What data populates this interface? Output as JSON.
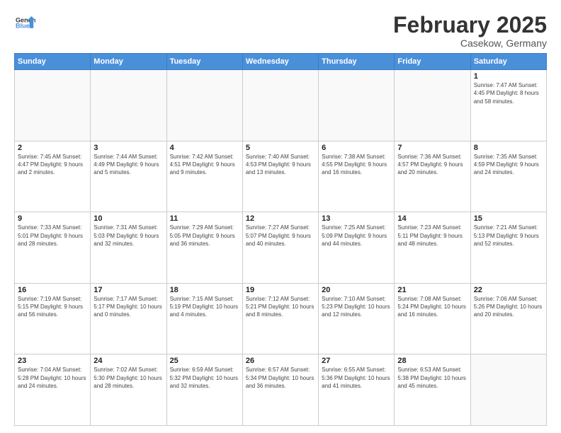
{
  "header": {
    "logo_line1": "General",
    "logo_line2": "Blue",
    "month_title": "February 2025",
    "location": "Casekow, Germany"
  },
  "days_of_week": [
    "Sunday",
    "Monday",
    "Tuesday",
    "Wednesday",
    "Thursday",
    "Friday",
    "Saturday"
  ],
  "weeks": [
    [
      {
        "day": "",
        "info": ""
      },
      {
        "day": "",
        "info": ""
      },
      {
        "day": "",
        "info": ""
      },
      {
        "day": "",
        "info": ""
      },
      {
        "day": "",
        "info": ""
      },
      {
        "day": "",
        "info": ""
      },
      {
        "day": "1",
        "info": "Sunrise: 7:47 AM\nSunset: 4:45 PM\nDaylight: 8 hours\nand 58 minutes."
      }
    ],
    [
      {
        "day": "2",
        "info": "Sunrise: 7:45 AM\nSunset: 4:47 PM\nDaylight: 9 hours\nand 2 minutes."
      },
      {
        "day": "3",
        "info": "Sunrise: 7:44 AM\nSunset: 4:49 PM\nDaylight: 9 hours\nand 5 minutes."
      },
      {
        "day": "4",
        "info": "Sunrise: 7:42 AM\nSunset: 4:51 PM\nDaylight: 9 hours\nand 9 minutes."
      },
      {
        "day": "5",
        "info": "Sunrise: 7:40 AM\nSunset: 4:53 PM\nDaylight: 9 hours\nand 13 minutes."
      },
      {
        "day": "6",
        "info": "Sunrise: 7:38 AM\nSunset: 4:55 PM\nDaylight: 9 hours\nand 16 minutes."
      },
      {
        "day": "7",
        "info": "Sunrise: 7:36 AM\nSunset: 4:57 PM\nDaylight: 9 hours\nand 20 minutes."
      },
      {
        "day": "8",
        "info": "Sunrise: 7:35 AM\nSunset: 4:59 PM\nDaylight: 9 hours\nand 24 minutes."
      }
    ],
    [
      {
        "day": "9",
        "info": "Sunrise: 7:33 AM\nSunset: 5:01 PM\nDaylight: 9 hours\nand 28 minutes."
      },
      {
        "day": "10",
        "info": "Sunrise: 7:31 AM\nSunset: 5:03 PM\nDaylight: 9 hours\nand 32 minutes."
      },
      {
        "day": "11",
        "info": "Sunrise: 7:29 AM\nSunset: 5:05 PM\nDaylight: 9 hours\nand 36 minutes."
      },
      {
        "day": "12",
        "info": "Sunrise: 7:27 AM\nSunset: 5:07 PM\nDaylight: 9 hours\nand 40 minutes."
      },
      {
        "day": "13",
        "info": "Sunrise: 7:25 AM\nSunset: 5:09 PM\nDaylight: 9 hours\nand 44 minutes."
      },
      {
        "day": "14",
        "info": "Sunrise: 7:23 AM\nSunset: 5:11 PM\nDaylight: 9 hours\nand 48 minutes."
      },
      {
        "day": "15",
        "info": "Sunrise: 7:21 AM\nSunset: 5:13 PM\nDaylight: 9 hours\nand 52 minutes."
      }
    ],
    [
      {
        "day": "16",
        "info": "Sunrise: 7:19 AM\nSunset: 5:15 PM\nDaylight: 9 hours\nand 56 minutes."
      },
      {
        "day": "17",
        "info": "Sunrise: 7:17 AM\nSunset: 5:17 PM\nDaylight: 10 hours\nand 0 minutes."
      },
      {
        "day": "18",
        "info": "Sunrise: 7:15 AM\nSunset: 5:19 PM\nDaylight: 10 hours\nand 4 minutes."
      },
      {
        "day": "19",
        "info": "Sunrise: 7:12 AM\nSunset: 5:21 PM\nDaylight: 10 hours\nand 8 minutes."
      },
      {
        "day": "20",
        "info": "Sunrise: 7:10 AM\nSunset: 5:23 PM\nDaylight: 10 hours\nand 12 minutes."
      },
      {
        "day": "21",
        "info": "Sunrise: 7:08 AM\nSunset: 5:24 PM\nDaylight: 10 hours\nand 16 minutes."
      },
      {
        "day": "22",
        "info": "Sunrise: 7:06 AM\nSunset: 5:26 PM\nDaylight: 10 hours\nand 20 minutes."
      }
    ],
    [
      {
        "day": "23",
        "info": "Sunrise: 7:04 AM\nSunset: 5:28 PM\nDaylight: 10 hours\nand 24 minutes."
      },
      {
        "day": "24",
        "info": "Sunrise: 7:02 AM\nSunset: 5:30 PM\nDaylight: 10 hours\nand 28 minutes."
      },
      {
        "day": "25",
        "info": "Sunrise: 6:59 AM\nSunset: 5:32 PM\nDaylight: 10 hours\nand 32 minutes."
      },
      {
        "day": "26",
        "info": "Sunrise: 6:57 AM\nSunset: 5:34 PM\nDaylight: 10 hours\nand 36 minutes."
      },
      {
        "day": "27",
        "info": "Sunrise: 6:55 AM\nSunset: 5:36 PM\nDaylight: 10 hours\nand 41 minutes."
      },
      {
        "day": "28",
        "info": "Sunrise: 6:53 AM\nSunset: 5:38 PM\nDaylight: 10 hours\nand 45 minutes."
      },
      {
        "day": "",
        "info": ""
      }
    ]
  ]
}
